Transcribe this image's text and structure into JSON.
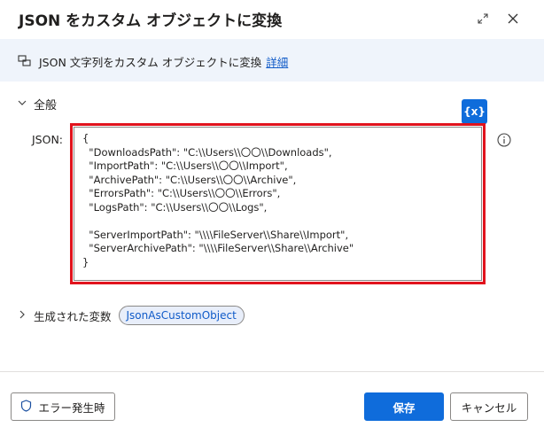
{
  "dialog": {
    "title": "JSON をカスタム オブジェクトに変換"
  },
  "info": {
    "text": "JSON 文字列をカスタム オブジェクトに変換",
    "link": "詳細"
  },
  "general": {
    "label": "全般",
    "var_button": "{x}",
    "json_label": "JSON:",
    "json_value": "{\n  \"DownloadsPath\": \"C:\\\\Users\\\\〇〇\\\\Downloads\",\n  \"ImportPath\": \"C:\\\\Users\\\\〇〇\\\\Import\",\n  \"ArchivePath\": \"C:\\\\Users\\\\〇〇\\\\Archive\",\n  \"ErrorsPath\": \"C:\\\\Users\\\\〇〇\\\\Errors\",\n  \"LogsPath\": \"C:\\\\Users\\\\〇〇\\\\Logs\",\n\n  \"ServerImportPath\": \"\\\\\\\\FileServer\\\\Share\\\\Import\",\n  \"ServerArchivePath\": \"\\\\\\\\FileServer\\\\Share\\\\Archive\"\n}"
  },
  "variables": {
    "label": "生成された変数",
    "produced": "JsonAsCustomObject"
  },
  "footer": {
    "error_button": "エラー発生時",
    "save_button": "保存",
    "cancel_button": "キャンセル"
  },
  "colors": {
    "accent": "#0f6cdb",
    "highlight_border": "#e1131d",
    "info_background": "#eff4fb"
  }
}
